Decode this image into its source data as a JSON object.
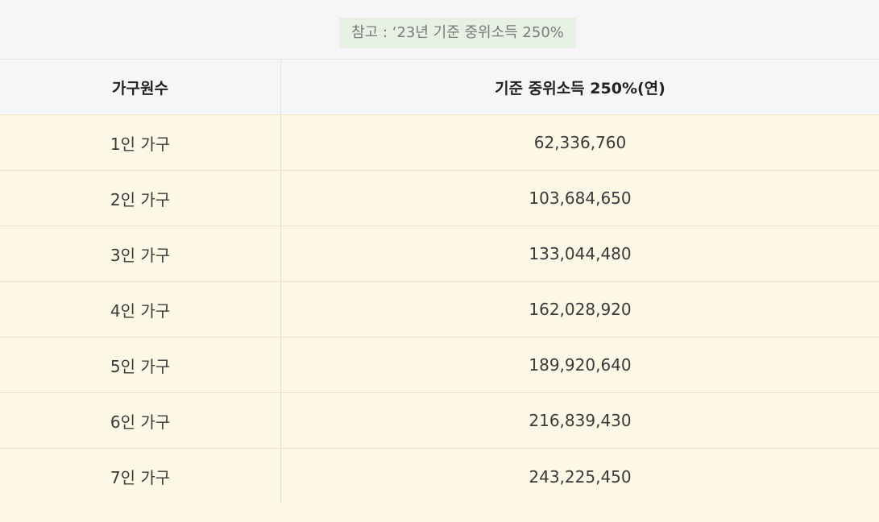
{
  "note": "참고 : ‘23년 기준 중위소득 250%",
  "table": {
    "headers": [
      "가구원수",
      "기준 중위소득 250%(연)"
    ],
    "rows": [
      {
        "household": "1인 가구",
        "amount": "62,336,760"
      },
      {
        "household": "2인 가구",
        "amount": "103,684,650"
      },
      {
        "household": "3인 가구",
        "amount": "133,044,480"
      },
      {
        "household": "4인 가구",
        "amount": "162,028,920"
      },
      {
        "household": "5인 가구",
        "amount": "189,920,640"
      },
      {
        "household": "6인 가구",
        "amount": "216,839,430"
      },
      {
        "household": "7인 가구",
        "amount": "243,225,450"
      }
    ]
  },
  "colors": {
    "header_bg": "#f6f6f9",
    "row_bg": "#fdf7e5",
    "note_bg": "#e7f1e3"
  }
}
